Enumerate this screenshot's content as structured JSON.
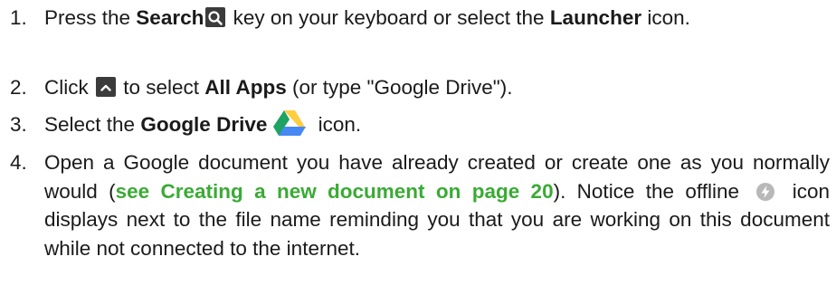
{
  "steps": [
    {
      "num": "1.",
      "t1": "Press the ",
      "b1": "Search",
      "t2": " key on your keyboard or select the ",
      "b2": "Launcher",
      "t3": " icon."
    },
    {
      "num": "2.",
      "t1": "Click ",
      "t2": " to select ",
      "b1": "All Apps",
      "t3": " (or type \"Google Drive\")."
    },
    {
      "num": "3.",
      "t1": "Select the ",
      "b1": "Google Drive",
      "t2": " icon."
    },
    {
      "num": "4.",
      "t1": "Open a Google document you have already created or create one as you normally would (",
      "link": "see Creating a new document on page 20",
      "t2": "). Notice the offline ",
      "t3": " icon displays next to the file name reminding you that you are working on this document while not connected to the internet."
    }
  ],
  "icons": {
    "search": "search-icon",
    "chevron": "chevron-up-icon",
    "drive": "google-drive-icon",
    "offline": "offline-icon"
  },
  "colors": {
    "link": "#3aaa35",
    "icon_box": "#3b3b3b",
    "drive_green": "#1ea362",
    "drive_yellow": "#ffcd40",
    "drive_blue": "#4688f4",
    "offline_circle": "#b8b8b8"
  }
}
